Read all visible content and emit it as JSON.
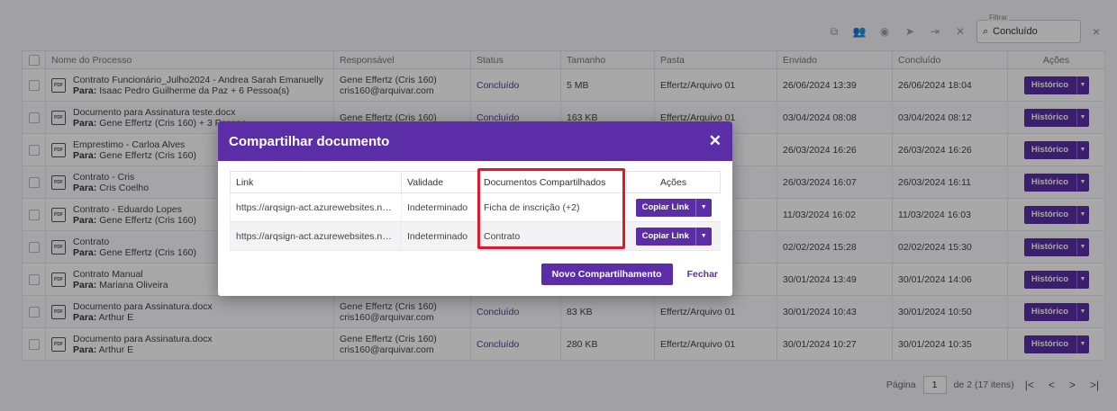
{
  "toolbar": {
    "filter_label": "Filtrar",
    "filter_value": "Concluído"
  },
  "grid": {
    "columns": [
      "Nome do Processo",
      "Responsável",
      "Status",
      "Tamanho",
      "Pasta",
      "Enviado",
      "Concluído",
      "Ações"
    ],
    "to_prefix": "Para:",
    "history_label": "Histórico",
    "rows": [
      {
        "name": "Contrato Funcionário_Julho2024 - Andrea Sarah Emanuelly",
        "to": "Isaac Pedro Guilherme da Paz + 6 Pessoa(s)",
        "owner": "Gene Effertz (Cris 160)",
        "email": "cris160@arquivar.com",
        "status": "Concluído",
        "size": "5 MB",
        "folder": "Effertz/Arquivo 01",
        "sent": "26/06/2024 13:39",
        "done": "26/06/2024 18:04"
      },
      {
        "name": "Documento para Assinatura teste.docx",
        "to": "Gene Effertz (Cris 160) + 3 Pessoa",
        "owner": "Gene Effertz (Cris 160)",
        "email": "",
        "status": "Concluído",
        "size": "163 KB",
        "folder": "Effertz/Arquivo 01",
        "sent": "03/04/2024 08:08",
        "done": "03/04/2024 08:12"
      },
      {
        "name": "Emprestimo - Carloa Alves",
        "to": "Gene Effertz (Cris 160)",
        "owner": "",
        "email": "",
        "status": "",
        "size": "",
        "folder": "",
        "sent": "26/03/2024 16:26",
        "done": "26/03/2024 16:26"
      },
      {
        "name": "Contrato - Cris",
        "to": "Cris Coelho",
        "owner": "",
        "email": "",
        "status": "",
        "size": "",
        "folder": "",
        "sent": "26/03/2024 16:07",
        "done": "26/03/2024 16:11"
      },
      {
        "name": "Contrato - Eduardo Lopes",
        "to": "Gene Effertz (Cris 160)",
        "owner": "",
        "email": "",
        "status": "",
        "size": "",
        "folder": "",
        "sent": "11/03/2024 16:02",
        "done": "11/03/2024 16:03"
      },
      {
        "name": "Contrato",
        "to": "Gene Effertz (Cris 160)",
        "owner": "",
        "email": "",
        "status": "",
        "size": "",
        "folder": "",
        "sent": "02/02/2024 15:28",
        "done": "02/02/2024 15:30"
      },
      {
        "name": "Contrato Manual",
        "to": "Mariana Oliveira",
        "owner": "",
        "email": "",
        "status": "",
        "size": "",
        "folder": "",
        "sent": "30/01/2024 13:49",
        "done": "30/01/2024 14:06"
      },
      {
        "name": "Documento para Assinatura.docx",
        "to": "Arthur E",
        "owner": "Gene Effertz (Cris 160)",
        "email": "cris160@arquivar.com",
        "status": "Concluído",
        "size": "83 KB",
        "folder": "Effertz/Arquivo 01",
        "sent": "30/01/2024 10:43",
        "done": "30/01/2024 10:50"
      },
      {
        "name": "Documento para Assinatura.docx",
        "to": "Arthur E",
        "owner": "Gene Effertz (Cris 160)",
        "email": "cris160@arquivar.com",
        "status": "Concluído",
        "size": "280 KB",
        "folder": "Effertz/Arquivo 01",
        "sent": "30/01/2024 10:27",
        "done": "30/01/2024 10:35"
      }
    ]
  },
  "pager": {
    "label": "Página",
    "page": "1",
    "total": "de 2 (17 itens)"
  },
  "modal": {
    "title": "Compartilhar documento",
    "columns": [
      "Link",
      "Validade",
      "Documentos Compartilhados",
      "Ações"
    ],
    "copy_label": "Copiar Link",
    "shares": [
      {
        "link": "https://arqsign-act.azurewebsites.net/sig...",
        "validity": "Indeterminado",
        "docs": "Ficha de inscrição (+2)"
      },
      {
        "link": "https://arqsign-act.azurewebsites.net/sig...",
        "validity": "Indeterminado",
        "docs": "Contrato"
      }
    ],
    "new_share_label": "Novo Compartilhamento",
    "close_label": "Fechar"
  }
}
